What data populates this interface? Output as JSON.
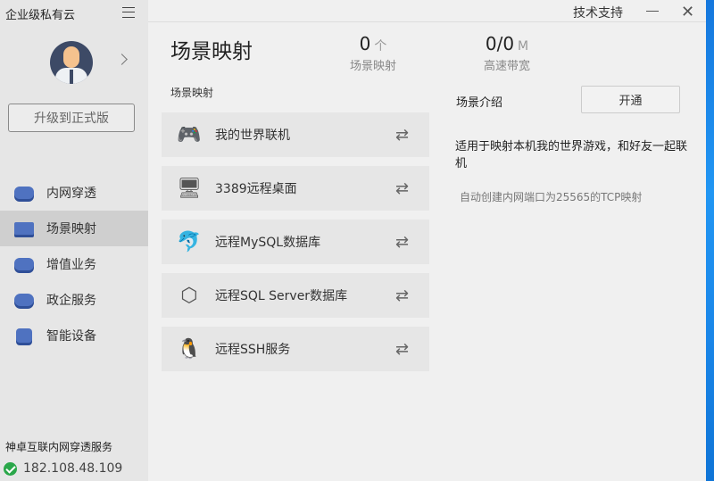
{
  "app": {
    "title": "企业级私有云",
    "tech_support": "技术支持"
  },
  "sidebar": {
    "upgrade_label": "升级到正式版",
    "items": [
      {
        "label": "内网穿透"
      },
      {
        "label": "场景映射"
      },
      {
        "label": "增值业务"
      },
      {
        "label": "政企服务"
      },
      {
        "label": "智能设备"
      }
    ],
    "active": 1,
    "service_name": "神卓互联内网穿透服务",
    "ip": "182.108.48.109"
  },
  "main": {
    "title": "场景映射",
    "stats": [
      {
        "value": "0",
        "unit": "个",
        "label": "场景映射"
      },
      {
        "value": "0/0",
        "unit": "M",
        "label": "高速带宽"
      }
    ],
    "section_label": "场景映射",
    "scenes": [
      {
        "label": "我的世界联机",
        "icon": "gamepad-icon"
      },
      {
        "label": "3389远程桌面",
        "icon": "monitor-icon"
      },
      {
        "label": "远程MySQL数据库",
        "icon": "mysql-dolphin-icon"
      },
      {
        "label": "远程SQL Server数据库",
        "icon": "sql-server-icon"
      },
      {
        "label": "远程SSH服务",
        "icon": "linux-penguin-icon"
      }
    ]
  },
  "intro": {
    "label": "场景介绍",
    "open_label": "开通",
    "description": "适用于映射本机我的世界游戏，和好友一起联机",
    "note": "自动创建内网端口为25565的TCP映射"
  }
}
